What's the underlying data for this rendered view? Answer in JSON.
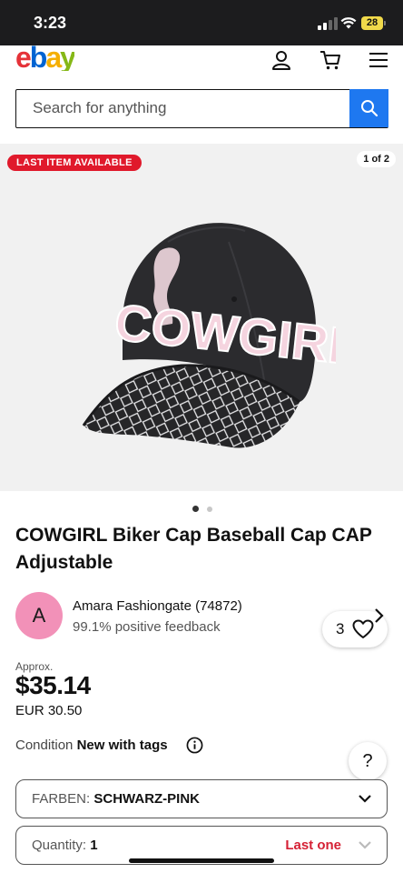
{
  "status_bar": {
    "time": "3:23",
    "battery": "28"
  },
  "header": {
    "logo": {
      "e": "e",
      "b": "b",
      "a": "a",
      "y": "y"
    }
  },
  "search": {
    "placeholder": "Search for anything"
  },
  "gallery": {
    "badge": "LAST ITEM AVAILABLE",
    "counter": "1 of 2",
    "cap_text": "COWGIRL",
    "watchers": "3",
    "page_dots": {
      "total": 2,
      "active": 1
    }
  },
  "listing": {
    "title": "COWGIRL Biker Cap Baseball Cap CAP Adjustable",
    "seller": {
      "initial": "A",
      "name": "Amara Fashiongate (74872)",
      "feedback": "99.1% positive feedback"
    },
    "price": {
      "approx_label": "Approx.",
      "value": "$35.14",
      "original": "EUR 30.50"
    },
    "condition": {
      "label": "Condition",
      "value": "New with tags"
    },
    "help": "?"
  },
  "selectors": {
    "color": {
      "label": "FARBEN:",
      "value": "SCHWARZ-PINK"
    },
    "quantity": {
      "label": "Quantity:",
      "value": "1",
      "note": "Last one"
    }
  },
  "colors": {
    "accent_blue": "#1e78f0",
    "badge_red": "#e0192b",
    "avatar_pink": "#f291b8"
  }
}
